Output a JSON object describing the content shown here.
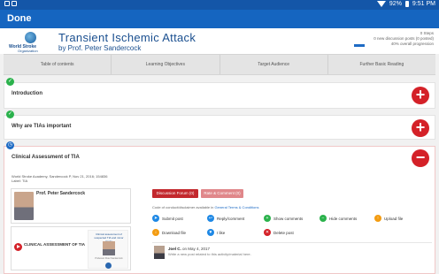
{
  "status_bar": {
    "left_icons": "square-icons",
    "battery": "92%",
    "time": "9:51 PM"
  },
  "app_bar": {
    "done_label": "Done"
  },
  "header": {
    "logo_line1": "World Stroke",
    "logo_line2": "Organization",
    "title": "Transient Ischemic Attack",
    "subtitle": "by Prof. Peter Sandercock",
    "stats": [
      "0 Steps",
      "0 new discussion posts (0 posted)",
      "40% overall progression"
    ],
    "progress_fraction": 0.4
  },
  "tabs": [
    "Table of contents",
    "Learning Objectives",
    "Target Audience",
    "Further Basic Reading"
  ],
  "sections": [
    {
      "label": "Introduction",
      "status": "complete",
      "button": "+"
    },
    {
      "label": "Why are TIAs important",
      "status": "complete",
      "button": "+"
    },
    {
      "label": "Clinical Assessment of TIA",
      "status": "in-progress",
      "button": "−"
    }
  ],
  "clinical": {
    "meta_line1": "World Stroke Academy, Sandercock P, Nov 21, 2016; 154836",
    "meta_line2": "Label: TIA",
    "author_name": "Prof. Peter Sandercock",
    "video_title": "CLINICAL ASSESSMENT OF TIA",
    "slide_title": "Clinical assessment of suspected TIA and minor stroke",
    "slide_caption": "Professor Peter Sandercock"
  },
  "discussion": {
    "forum_label": "Discussion Forum (0)",
    "rate_label": "Rate & Comment (0)",
    "code_text": "Code of conduct/disclaimer available in",
    "code_link": "General Terms & Conditions",
    "actions": [
      {
        "label": "Submit post",
        "color": "#1e88e5",
        "icon": "send-icon"
      },
      {
        "label": "Reply/comment",
        "color": "#1e88e5",
        "icon": "reply-icon"
      },
      {
        "label": "Show comments",
        "color": "#2bb24c",
        "icon": "show-icon"
      },
      {
        "label": "Hide comments",
        "color": "#2bb24c",
        "icon": "hide-icon"
      },
      {
        "label": "Upload file",
        "color": "#f39c12",
        "icon": "upload-icon"
      },
      {
        "label": "Download file",
        "color": "#f39c12",
        "icon": "download-icon"
      },
      {
        "label": "I like",
        "color": "#1e88e5",
        "icon": "like-icon"
      },
      {
        "label": "Delete post",
        "color": "#d42128",
        "icon": "delete-icon"
      }
    ],
    "post_author": "Joel C.",
    "post_date": "on May 4, 2017",
    "post_placeholder": "Write a new post related to this activity/material here."
  }
}
